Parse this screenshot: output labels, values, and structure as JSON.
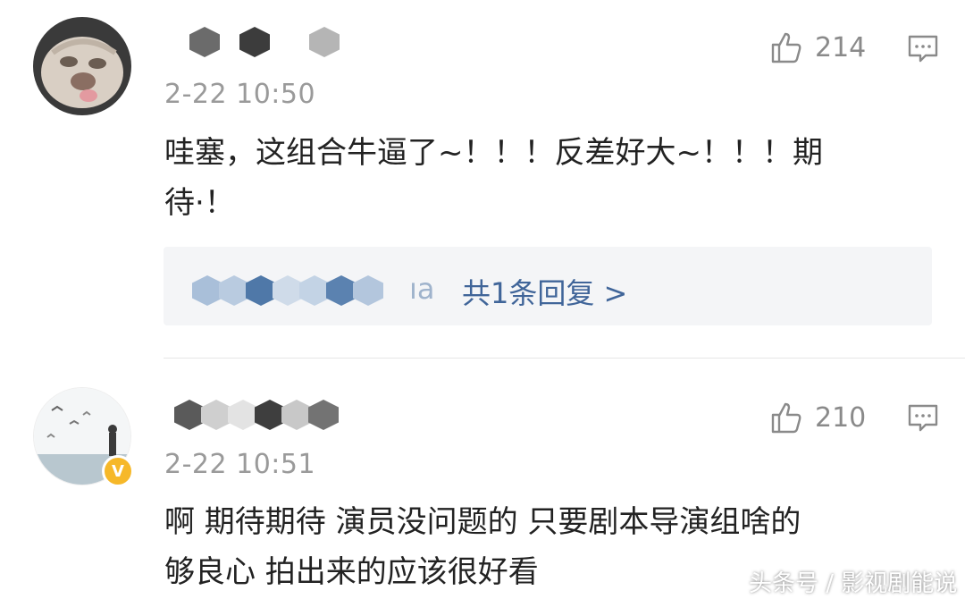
{
  "comments": [
    {
      "timestamp": "2-22 10:50",
      "like_count": "214",
      "text_line1": "哇塞，这组合牛逼了~！！！反差好大~！！！期",
      "text_line2": "待·！",
      "reply_summary": "共1条回复 >",
      "reply_user_tail": "ıa"
    },
    {
      "timestamp": "2-22 10:51",
      "like_count": "210",
      "text_line1": "啊 期待期待  演员没问题的 只要剧本导演组啥的",
      "text_line2": "够良心  拍出来的应该很好看",
      "verified_badge": "V"
    }
  ],
  "watermark": "头条号 / 影视剧能说",
  "colors": {
    "link_blue": "#406599",
    "timestamp_gray": "#9a9a9a",
    "badge_gold": "#f6b829",
    "reply_bg": "#f4f5f7"
  },
  "icons": [
    "thumbs-up-icon",
    "comment-icon",
    "chevron-right-icon",
    "verified-v-icon"
  ]
}
